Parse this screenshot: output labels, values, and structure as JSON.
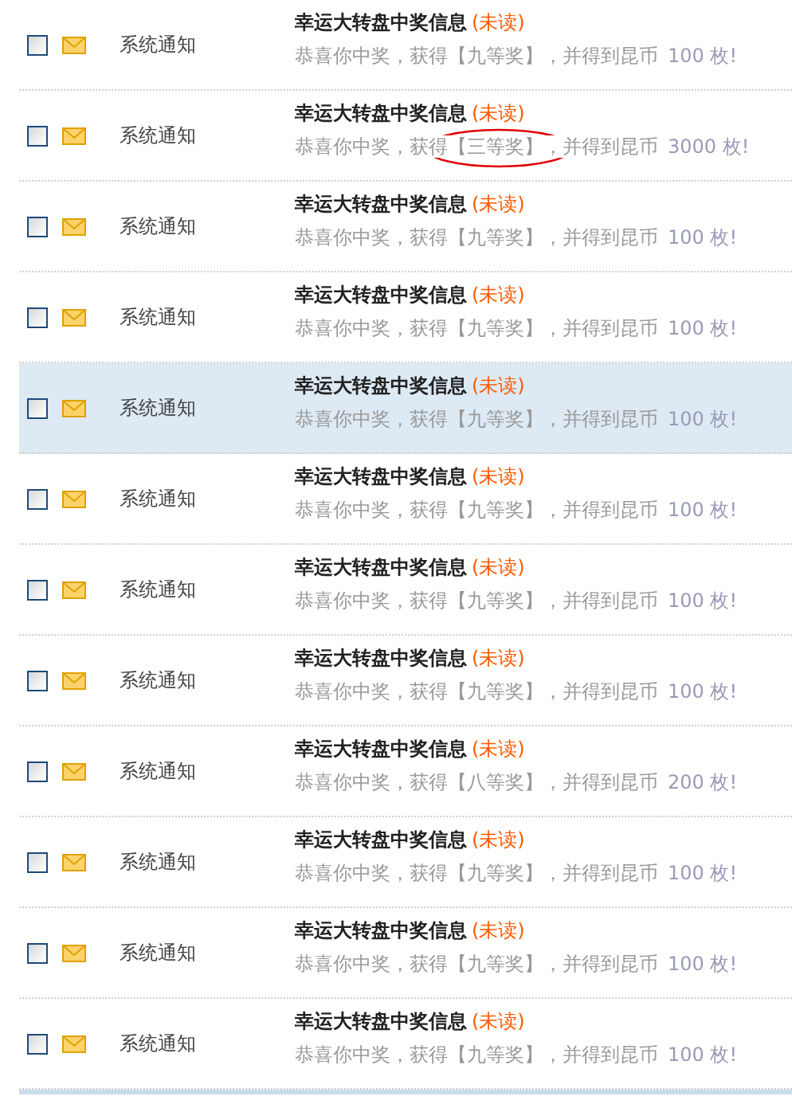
{
  "messages": [
    {
      "checked": false,
      "highlighted": false,
      "circled": false,
      "sender": "系统通知",
      "title": "幸运大转盘中奖信息",
      "status": "(未读)",
      "body": "恭喜你中奖，获得【九等奖】，并得到昆币",
      "amount": "100 枚!"
    },
    {
      "checked": false,
      "highlighted": false,
      "circled": true,
      "sender": "系统通知",
      "title": "幸运大转盘中奖信息",
      "status": "(未读)",
      "body": "恭喜你中奖，获得【三等奖】，并得到昆币",
      "amount": "3000 枚!"
    },
    {
      "checked": false,
      "highlighted": false,
      "circled": false,
      "sender": "系统通知",
      "title": "幸运大转盘中奖信息",
      "status": "(未读)",
      "body": "恭喜你中奖，获得【九等奖】，并得到昆币",
      "amount": "100 枚!"
    },
    {
      "checked": false,
      "highlighted": false,
      "circled": false,
      "sender": "系统通知",
      "title": "幸运大转盘中奖信息",
      "status": "(未读)",
      "body": "恭喜你中奖，获得【九等奖】，并得到昆币",
      "amount": "100 枚!"
    },
    {
      "checked": false,
      "highlighted": true,
      "circled": false,
      "sender": "系统通知",
      "title": "幸运大转盘中奖信息",
      "status": "(未读)",
      "body": "恭喜你中奖，获得【九等奖】，并得到昆币",
      "amount": "100 枚!"
    },
    {
      "checked": false,
      "highlighted": false,
      "circled": false,
      "sender": "系统通知",
      "title": "幸运大转盘中奖信息",
      "status": "(未读)",
      "body": "恭喜你中奖，获得【九等奖】，并得到昆币",
      "amount": "100 枚!"
    },
    {
      "checked": false,
      "highlighted": false,
      "circled": false,
      "sender": "系统通知",
      "title": "幸运大转盘中奖信息",
      "status": "(未读)",
      "body": "恭喜你中奖，获得【九等奖】，并得到昆币",
      "amount": "100 枚!"
    },
    {
      "checked": false,
      "highlighted": false,
      "circled": false,
      "sender": "系统通知",
      "title": "幸运大转盘中奖信息",
      "status": "(未读)",
      "body": "恭喜你中奖，获得【九等奖】，并得到昆币",
      "amount": "100 枚!"
    },
    {
      "checked": false,
      "highlighted": false,
      "circled": false,
      "sender": "系统通知",
      "title": "幸运大转盘中奖信息",
      "status": "(未读)",
      "body": "恭喜你中奖，获得【八等奖】，并得到昆币",
      "amount": "200 枚!"
    },
    {
      "checked": false,
      "highlighted": false,
      "circled": false,
      "sender": "系统通知",
      "title": "幸运大转盘中奖信息",
      "status": "(未读)",
      "body": "恭喜你中奖，获得【九等奖】，并得到昆币",
      "amount": "100 枚!"
    },
    {
      "checked": false,
      "highlighted": false,
      "circled": false,
      "sender": "系统通知",
      "title": "幸运大转盘中奖信息",
      "status": "(未读)",
      "body": "恭喜你中奖，获得【九等奖】，并得到昆币",
      "amount": "100 枚!"
    },
    {
      "checked": false,
      "highlighted": false,
      "circled": false,
      "sender": "系统通知",
      "title": "幸运大转盘中奖信息",
      "status": "(未读)",
      "body": "恭喜你中奖，获得【九等奖】，并得到昆币",
      "amount": "100 枚!"
    }
  ]
}
